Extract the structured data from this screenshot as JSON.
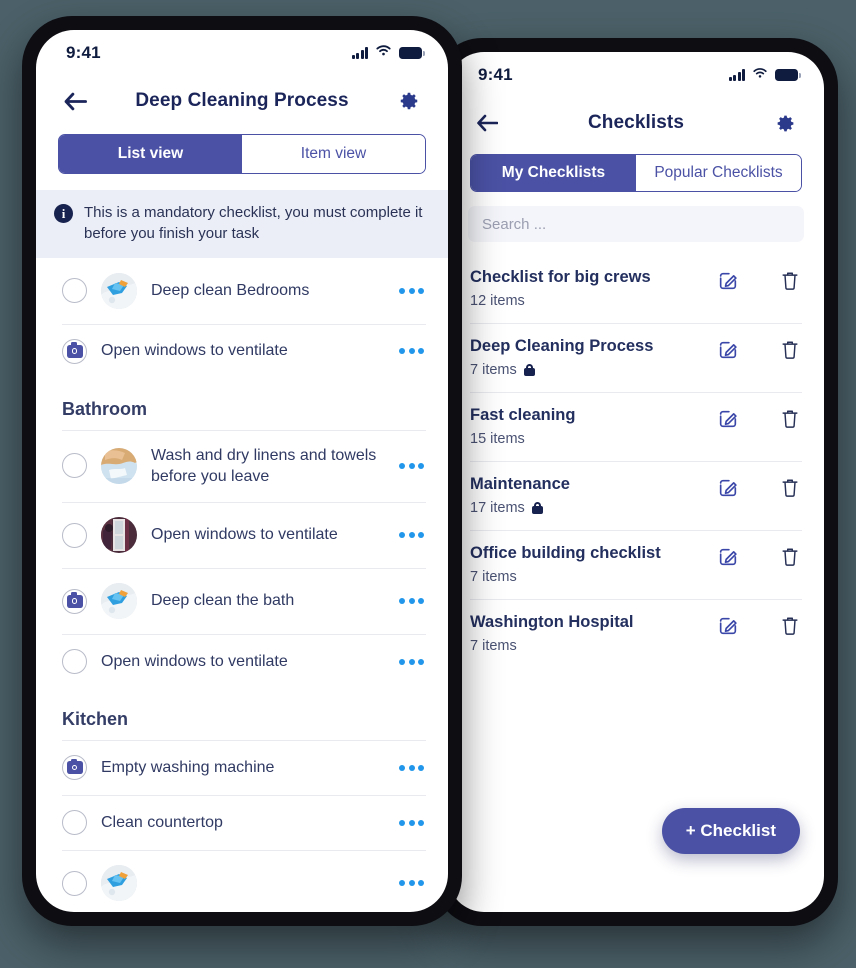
{
  "background_color": "#4b6068",
  "accent_color": "#4b52a5",
  "dots_color": "#2196ea",
  "text_color": "#303a63",
  "checklist_detail_screen": {
    "statusbar": {
      "time": "9:41",
      "signal_icon": "cellular-signal-icon",
      "wifi_icon": "wifi-icon",
      "battery_icon": "battery-icon"
    },
    "navbar": {
      "back_icon": "arrow-left-icon",
      "title": "Deep Cleaning Process",
      "settings_icon": "gear-icon"
    },
    "tabs": [
      {
        "label": "List view",
        "active": true
      },
      {
        "label": "Item view",
        "active": false
      }
    ],
    "info_banner": {
      "icon": "info-icon",
      "glyph": "i",
      "text": "This is a mandatory checklist, you must complete it before you finish  your task"
    },
    "items": [
      {
        "type": "task",
        "checkbox": "circle",
        "thumbnail": "cleaning-supplies-photo",
        "label": "Deep clean Bedrooms",
        "menu_icon": "more-options-icon"
      },
      {
        "type": "task",
        "checkbox": "camera",
        "thumbnail": null,
        "label": "Open windows to ventilate",
        "menu_icon": "more-options-icon"
      },
      {
        "type": "section",
        "label": "Bathroom"
      },
      {
        "type": "task",
        "checkbox": "circle",
        "thumbnail": "linens-towels-photo",
        "label": "Wash and dry linens and towels before you leave",
        "menu_icon": "more-options-icon"
      },
      {
        "type": "task",
        "checkbox": "circle",
        "thumbnail": "window-person-photo",
        "label": "Open windows to ventilate",
        "menu_icon": "more-options-icon"
      },
      {
        "type": "task",
        "checkbox": "camera",
        "thumbnail": "cleaning-supplies-photo",
        "label": "Deep clean the bath",
        "menu_icon": "more-options-icon"
      },
      {
        "type": "task",
        "checkbox": "circle",
        "thumbnail": null,
        "label": "Open windows to ventilate",
        "menu_icon": "more-options-icon"
      },
      {
        "type": "section",
        "label": "Kitchen"
      },
      {
        "type": "task",
        "checkbox": "camera",
        "thumbnail": null,
        "label": "Empty washing machine",
        "menu_icon": "more-options-icon"
      },
      {
        "type": "task",
        "checkbox": "circle",
        "thumbnail": null,
        "label": "Clean countertop",
        "menu_icon": "more-options-icon"
      },
      {
        "type": "task",
        "checkbox": "circle",
        "thumbnail": "cleaning-supplies-photo",
        "label": "",
        "menu_icon": "more-options-icon"
      }
    ]
  },
  "checklists_screen": {
    "statusbar": {
      "time": "9:41",
      "signal_icon": "cellular-signal-icon",
      "wifi_icon": "wifi-icon",
      "battery_icon": "battery-icon"
    },
    "navbar": {
      "back_icon": "arrow-left-icon",
      "title": "Checklists",
      "settings_icon": "gear-icon"
    },
    "tabs": [
      {
        "label": "My Checklists",
        "active": true
      },
      {
        "label": "Popular Checklists",
        "active": false
      }
    ],
    "search": {
      "placeholder": "Search ...",
      "value": ""
    },
    "checklists": [
      {
        "name": "Checklist for big crews",
        "items_label": "12 items",
        "locked": false,
        "edit_icon": "edit-icon",
        "delete_icon": "trash-icon"
      },
      {
        "name": "Deep Cleaning Process",
        "items_label": "7 items",
        "locked": true,
        "lock_icon": "lock-icon",
        "edit_icon": "edit-icon",
        "delete_icon": "trash-icon"
      },
      {
        "name": "Fast cleaning",
        "items_label": "15 items",
        "locked": false,
        "edit_icon": "edit-icon",
        "delete_icon": "trash-icon"
      },
      {
        "name": "Maintenance",
        "items_label": "17 items",
        "locked": true,
        "lock_icon": "lock-icon",
        "edit_icon": "edit-icon",
        "delete_icon": "trash-icon"
      },
      {
        "name": "Office building checklist",
        "items_label": "7 items",
        "locked": false,
        "edit_icon": "edit-icon",
        "delete_icon": "trash-icon"
      },
      {
        "name": "Washington Hospital",
        "items_label": "7 items",
        "locked": false,
        "edit_icon": "edit-icon",
        "delete_icon": "trash-icon"
      }
    ],
    "fab": {
      "label": "+ Checklist"
    }
  }
}
